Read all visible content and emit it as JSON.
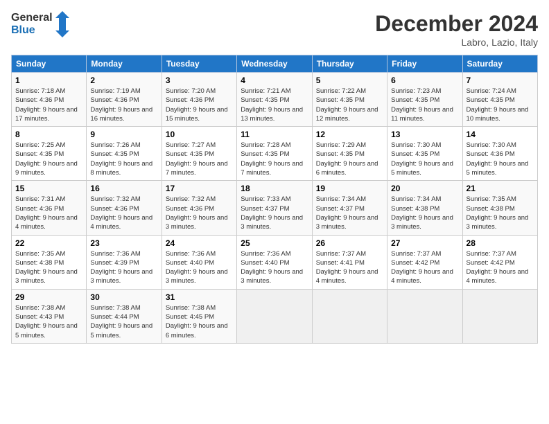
{
  "logo": {
    "general": "General",
    "blue": "Blue"
  },
  "header": {
    "month": "December 2024",
    "location": "Labro, Lazio, Italy"
  },
  "weekdays": [
    "Sunday",
    "Monday",
    "Tuesday",
    "Wednesday",
    "Thursday",
    "Friday",
    "Saturday"
  ],
  "weeks": [
    [
      {
        "day": "1",
        "sunrise": "7:18 AM",
        "sunset": "4:36 PM",
        "daylight": "9 hours and 17 minutes."
      },
      {
        "day": "2",
        "sunrise": "7:19 AM",
        "sunset": "4:36 PM",
        "daylight": "9 hours and 16 minutes."
      },
      {
        "day": "3",
        "sunrise": "7:20 AM",
        "sunset": "4:36 PM",
        "daylight": "9 hours and 15 minutes."
      },
      {
        "day": "4",
        "sunrise": "7:21 AM",
        "sunset": "4:35 PM",
        "daylight": "9 hours and 13 minutes."
      },
      {
        "day": "5",
        "sunrise": "7:22 AM",
        "sunset": "4:35 PM",
        "daylight": "9 hours and 12 minutes."
      },
      {
        "day": "6",
        "sunrise": "7:23 AM",
        "sunset": "4:35 PM",
        "daylight": "9 hours and 11 minutes."
      },
      {
        "day": "7",
        "sunrise": "7:24 AM",
        "sunset": "4:35 PM",
        "daylight": "9 hours and 10 minutes."
      }
    ],
    [
      {
        "day": "8",
        "sunrise": "7:25 AM",
        "sunset": "4:35 PM",
        "daylight": "9 hours and 9 minutes."
      },
      {
        "day": "9",
        "sunrise": "7:26 AM",
        "sunset": "4:35 PM",
        "daylight": "9 hours and 8 minutes."
      },
      {
        "day": "10",
        "sunrise": "7:27 AM",
        "sunset": "4:35 PM",
        "daylight": "9 hours and 7 minutes."
      },
      {
        "day": "11",
        "sunrise": "7:28 AM",
        "sunset": "4:35 PM",
        "daylight": "9 hours and 7 minutes."
      },
      {
        "day": "12",
        "sunrise": "7:29 AM",
        "sunset": "4:35 PM",
        "daylight": "9 hours and 6 minutes."
      },
      {
        "day": "13",
        "sunrise": "7:30 AM",
        "sunset": "4:35 PM",
        "daylight": "9 hours and 5 minutes."
      },
      {
        "day": "14",
        "sunrise": "7:30 AM",
        "sunset": "4:36 PM",
        "daylight": "9 hours and 5 minutes."
      }
    ],
    [
      {
        "day": "15",
        "sunrise": "7:31 AM",
        "sunset": "4:36 PM",
        "daylight": "9 hours and 4 minutes."
      },
      {
        "day": "16",
        "sunrise": "7:32 AM",
        "sunset": "4:36 PM",
        "daylight": "9 hours and 4 minutes."
      },
      {
        "day": "17",
        "sunrise": "7:32 AM",
        "sunset": "4:36 PM",
        "daylight": "9 hours and 3 minutes."
      },
      {
        "day": "18",
        "sunrise": "7:33 AM",
        "sunset": "4:37 PM",
        "daylight": "9 hours and 3 minutes."
      },
      {
        "day": "19",
        "sunrise": "7:34 AM",
        "sunset": "4:37 PM",
        "daylight": "9 hours and 3 minutes."
      },
      {
        "day": "20",
        "sunrise": "7:34 AM",
        "sunset": "4:38 PM",
        "daylight": "9 hours and 3 minutes."
      },
      {
        "day": "21",
        "sunrise": "7:35 AM",
        "sunset": "4:38 PM",
        "daylight": "9 hours and 3 minutes."
      }
    ],
    [
      {
        "day": "22",
        "sunrise": "7:35 AM",
        "sunset": "4:38 PM",
        "daylight": "9 hours and 3 minutes."
      },
      {
        "day": "23",
        "sunrise": "7:36 AM",
        "sunset": "4:39 PM",
        "daylight": "9 hours and 3 minutes."
      },
      {
        "day": "24",
        "sunrise": "7:36 AM",
        "sunset": "4:40 PM",
        "daylight": "9 hours and 3 minutes."
      },
      {
        "day": "25",
        "sunrise": "7:36 AM",
        "sunset": "4:40 PM",
        "daylight": "9 hours and 3 minutes."
      },
      {
        "day": "26",
        "sunrise": "7:37 AM",
        "sunset": "4:41 PM",
        "daylight": "9 hours and 4 minutes."
      },
      {
        "day": "27",
        "sunrise": "7:37 AM",
        "sunset": "4:42 PM",
        "daylight": "9 hours and 4 minutes."
      },
      {
        "day": "28",
        "sunrise": "7:37 AM",
        "sunset": "4:42 PM",
        "daylight": "9 hours and 4 minutes."
      }
    ],
    [
      {
        "day": "29",
        "sunrise": "7:38 AM",
        "sunset": "4:43 PM",
        "daylight": "9 hours and 5 minutes."
      },
      {
        "day": "30",
        "sunrise": "7:38 AM",
        "sunset": "4:44 PM",
        "daylight": "9 hours and 5 minutes."
      },
      {
        "day": "31",
        "sunrise": "7:38 AM",
        "sunset": "4:45 PM",
        "daylight": "9 hours and 6 minutes."
      },
      null,
      null,
      null,
      null
    ]
  ],
  "labels": {
    "sunrise": "Sunrise:",
    "sunset": "Sunset:",
    "daylight": "Daylight:"
  }
}
